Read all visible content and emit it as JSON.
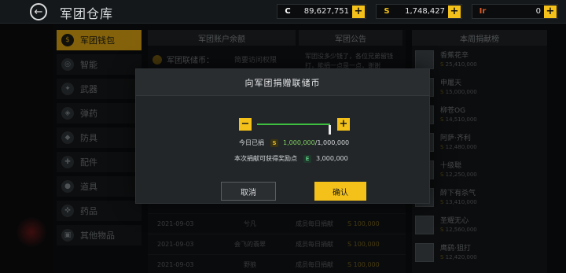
{
  "topbar": {
    "title": "军团仓库",
    "currencies": [
      {
        "icon": "C",
        "value": "89,627,751",
        "color": "#ffffff"
      },
      {
        "icon": "S",
        "value": "1,748,427",
        "color": "#f3c11a"
      },
      {
        "icon": "Ir",
        "value": "0",
        "color": "#e05a2a"
      }
    ]
  },
  "sidebar": {
    "items": [
      {
        "label": "军团钱包",
        "icon": "$"
      },
      {
        "label": "智能",
        "icon": "◎"
      },
      {
        "label": "武器",
        "icon": "✦"
      },
      {
        "label": "弹药",
        "icon": "◈"
      },
      {
        "label": "防具",
        "icon": "◆"
      },
      {
        "label": "配件",
        "icon": "✚"
      },
      {
        "label": "道具",
        "icon": "●"
      },
      {
        "label": "药品",
        "icon": "✜"
      },
      {
        "label": "其他物品",
        "icon": "▣"
      }
    ]
  },
  "main": {
    "tab_balance": "军团账户余额",
    "tab_notice": "军团公告",
    "fund_label": "军团联储币：",
    "fund_link": "简要访问权限",
    "notice_text": "军团没多少钱了，各位兄弟留钱打，能捐一点是一点，谢谢",
    "logs": [
      {
        "date": "2021-09-03",
        "name": "兮凡",
        "type": "成员每日捐献",
        "amount": "100,000"
      },
      {
        "date": "2021-09-03",
        "name": "会飞的翡翠",
        "type": "成员每日捐献",
        "amount": "100,000"
      },
      {
        "date": "2021-09-03",
        "name": "野狼",
        "type": "成员每日捐献",
        "amount": "100,000"
      }
    ]
  },
  "ranking": {
    "title": "本周捐献榜",
    "items": [
      {
        "name": "香蕉花辛",
        "score": "25,410,000"
      },
      {
        "name": "申屠天",
        "score": "15,000,000"
      },
      {
        "name": "柳苍OG",
        "score": "14,510,000"
      },
      {
        "name": "阿萨·齐利",
        "score": "12,480,000"
      },
      {
        "name": "十级聪",
        "score": "12,250,000"
      },
      {
        "name": "醉下有杀气",
        "score": "13,410,000"
      },
      {
        "name": "圣耀无心",
        "score": "12,560,000"
      },
      {
        "name": "鹰鹞·狙打",
        "score": "12,420,000"
      }
    ]
  },
  "modal": {
    "title": "向军团捐赠联储币",
    "slider_fraction": 1.0,
    "today_label": "今日已捐",
    "today_icon": "S",
    "today_value": "1,000,000",
    "today_max": "/1,000,000",
    "reward_label": "本次捐献可获得奖励点",
    "reward_icon": "E",
    "reward_value": "3,000,000",
    "cancel_label": "取消",
    "confirm_label": "确认"
  },
  "colors": {
    "accent": "#f3c11a",
    "slider_fill": "#3fbf3f",
    "green_value": "#7fd160"
  }
}
